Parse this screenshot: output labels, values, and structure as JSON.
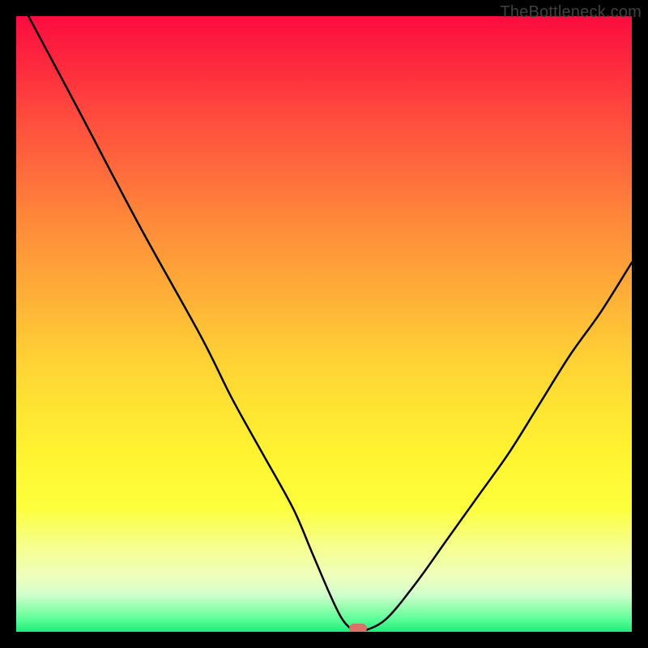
{
  "credit": "TheBottleneck.com",
  "chart_data": {
    "type": "line",
    "title": "",
    "subtitle": "",
    "xlabel": "",
    "ylabel": "",
    "xlim": [
      0,
      100
    ],
    "ylim": [
      0,
      100
    ],
    "x": [
      2,
      10,
      20,
      30,
      35,
      40,
      45,
      48,
      51,
      53,
      55,
      56,
      60,
      65,
      70,
      75,
      80,
      85,
      90,
      95,
      100
    ],
    "values": [
      100,
      85,
      66,
      48,
      38,
      29,
      20,
      13,
      6,
      2,
      0,
      0,
      2,
      8,
      15,
      22,
      29,
      37,
      45,
      52,
      60
    ],
    "marker": {
      "x": 55.5,
      "y": 0.5,
      "color": "#de7268"
    },
    "gradient_stops": [
      {
        "pos": 0.0,
        "color": "#fc0c3f"
      },
      {
        "pos": 0.5,
        "color": "#ffcf35"
      },
      {
        "pos": 0.85,
        "color": "#fdff3d"
      },
      {
        "pos": 1.0,
        "color": "#21eb7a"
      }
    ],
    "annotations": []
  }
}
